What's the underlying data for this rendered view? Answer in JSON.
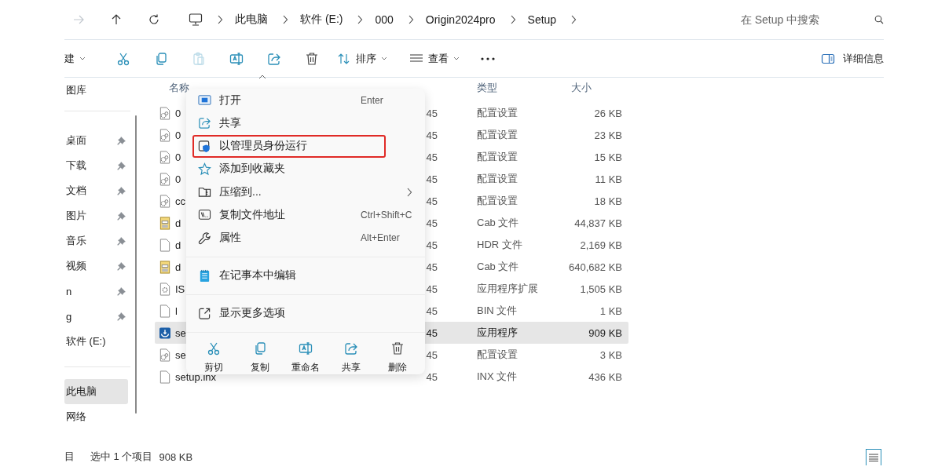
{
  "nav_buttons": [
    {
      "kind": "forward",
      "disabled": true
    },
    {
      "kind": "up",
      "disabled": false
    },
    {
      "kind": "refresh",
      "disabled": false
    }
  ],
  "breadcrumb": [
    "此电脑",
    "软件 (E:)",
    "000",
    "Origin2024pro",
    "Setup"
  ],
  "search": {
    "placeholder": "在 Setup 中搜索"
  },
  "toolbar": {
    "new_label": "建",
    "actions": [
      {
        "kind": "cut",
        "disabled": false
      },
      {
        "kind": "copy",
        "disabled": false
      },
      {
        "kind": "paste",
        "disabled": true
      },
      {
        "kind": "rename",
        "disabled": false
      },
      {
        "kind": "share",
        "disabled": false
      },
      {
        "kind": "delete",
        "disabled": false
      }
    ],
    "sort_label": "排序",
    "view_label": "查看",
    "details_label": "详细信息"
  },
  "sidebar": {
    "groups": [
      [
        {
          "label": "图库",
          "pinned": false,
          "selected": false
        }
      ],
      [
        {
          "label": "桌面",
          "pinned": true,
          "selected": false
        },
        {
          "label": "下载",
          "pinned": true,
          "selected": false
        },
        {
          "label": "文档",
          "pinned": true,
          "selected": false
        },
        {
          "label": "图片",
          "pinned": true,
          "selected": false
        },
        {
          "label": "音乐",
          "pinned": true,
          "selected": false
        },
        {
          "label": "视频",
          "pinned": true,
          "selected": false
        },
        {
          "label": "n",
          "pinned": true,
          "selected": false
        },
        {
          "label": "g",
          "pinned": true,
          "selected": false
        },
        {
          "label": "软件 (E:)",
          "pinned": false,
          "selected": false
        }
      ],
      [
        {
          "label": "此电脑",
          "pinned": false,
          "selected": true
        },
        {
          "label": "网络",
          "pinned": false,
          "selected": false
        }
      ]
    ]
  },
  "columns": [
    {
      "kind": "name",
      "label": "名称"
    },
    {
      "kind": "type",
      "label": "类型"
    },
    {
      "kind": "size",
      "label": "大小"
    }
  ],
  "files": [
    {
      "name": "0",
      "kind": "config",
      "date": "45",
      "type": "配置设置",
      "size": "26 KB",
      "selected": false
    },
    {
      "name": "0",
      "kind": "config",
      "date": "45",
      "type": "配置设置",
      "size": "23 KB",
      "selected": false
    },
    {
      "name": "0",
      "kind": "config",
      "date": "45",
      "type": "配置设置",
      "size": "15 KB",
      "selected": false
    },
    {
      "name": "0",
      "kind": "config",
      "date": "45",
      "type": "配置设置",
      "size": "11 KB",
      "selected": false
    },
    {
      "name": "cc",
      "kind": "config",
      "date": "45",
      "type": "配置设置",
      "size": "18 KB",
      "selected": false
    },
    {
      "name": "d",
      "kind": "cab",
      "date": "45",
      "type": "Cab 文件",
      "size": "44,837 KB",
      "selected": false
    },
    {
      "name": "d",
      "kind": "file",
      "date": "45",
      "type": "HDR 文件",
      "size": "2,169 KB",
      "selected": false
    },
    {
      "name": "d",
      "kind": "cab",
      "date": "45",
      "type": "Cab 文件",
      "size": "640,682 KB",
      "selected": false
    },
    {
      "name": "IS",
      "kind": "extension",
      "date": "45",
      "type": "应用程序扩展",
      "size": "1,505 KB",
      "selected": false
    },
    {
      "name": "l",
      "kind": "file",
      "date": "45",
      "type": "BIN 文件",
      "size": "1 KB",
      "selected": false
    },
    {
      "name": "se",
      "kind": "app",
      "date": "45",
      "type": "应用程序",
      "size": "909 KB",
      "selected": true
    },
    {
      "name": "se",
      "kind": "config",
      "date": "45",
      "type": "配置设置",
      "size": "3 KB",
      "selected": false
    },
    {
      "name": "setup.inx",
      "kind": "file",
      "date": "45",
      "type": "INX 文件",
      "size": "436 KB",
      "selected": false
    }
  ],
  "context_menu": {
    "groups": [
      [
        {
          "label": "打开",
          "shortcut": "Enter",
          "kind": "open",
          "highlighted": false,
          "submenu": false
        },
        {
          "label": "共享",
          "kind": "share",
          "highlighted": false,
          "submenu": false
        },
        {
          "label": "以管理员身份运行",
          "kind": "admin",
          "highlighted": true,
          "submenu": false
        },
        {
          "label": "添加到收藏夹",
          "kind": "star",
          "highlighted": false,
          "submenu": false
        },
        {
          "label": "压缩到...",
          "kind": "zip",
          "highlighted": false,
          "submenu": true
        },
        {
          "label": "复制文件地址",
          "shortcut": "Ctrl+Shift+C",
          "kind": "path",
          "highlighted": false,
          "submenu": false
        },
        {
          "label": "属性",
          "shortcut": "Alt+Enter",
          "kind": "wrench",
          "highlighted": false,
          "submenu": false
        }
      ],
      [
        {
          "label": "在记事本中编辑",
          "kind": "notepad",
          "highlighted": false,
          "submenu": false
        }
      ],
      [
        {
          "label": "显示更多选项",
          "kind": "more",
          "highlighted": false,
          "submenu": false
        }
      ]
    ],
    "actions": [
      {
        "label": "剪切",
        "kind": "cut"
      },
      {
        "label": "复制",
        "kind": "copy"
      },
      {
        "label": "重命名",
        "kind": "rename"
      },
      {
        "label": "共享",
        "kind": "share"
      },
      {
        "label": "删除",
        "kind": "delete"
      }
    ]
  },
  "status_bar": {
    "item_count": "目",
    "selection": "选中 1 个项目",
    "size": "908 KB"
  }
}
